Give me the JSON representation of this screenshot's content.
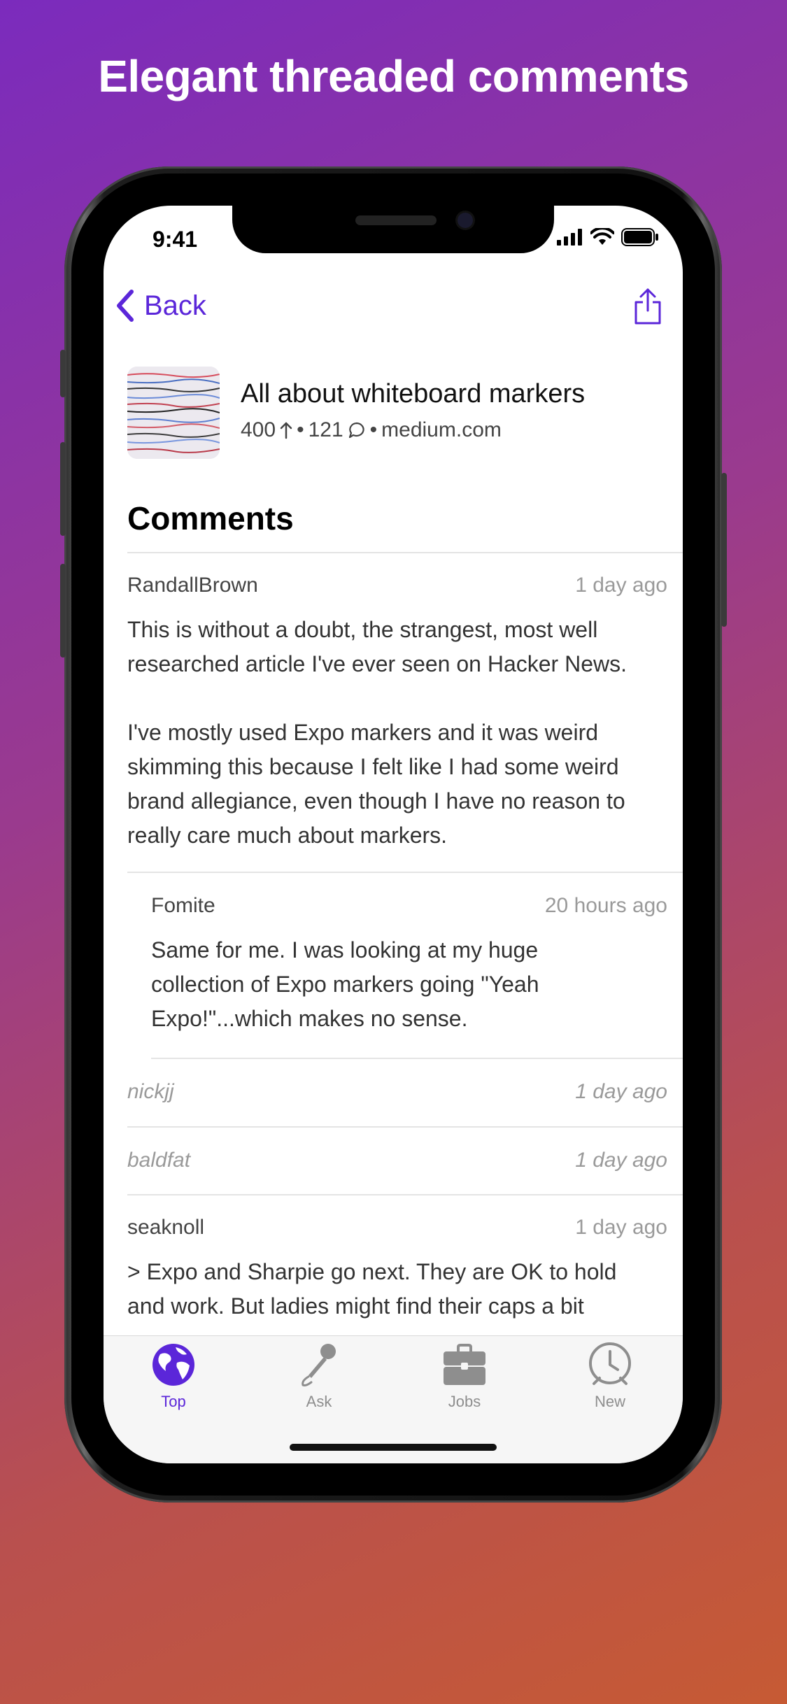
{
  "headline": "Elegant threaded comments",
  "status_bar": {
    "time": "9:41"
  },
  "nav": {
    "back_label": "Back"
  },
  "story": {
    "title": "All about whiteboard markers",
    "points": "400",
    "comments_count": "121",
    "separator": "•",
    "domain": "medium.com"
  },
  "comments_heading": "Comments",
  "comments": [
    {
      "author": "RandallBrown",
      "time": "1 day ago",
      "body": "This is without a doubt, the strangest, most well researched article I've ever seen on Hacker News.\n\nI've mostly used Expo markers and it was weird skimming this because I felt like I had some weird brand allegiance, even though I have no reason to really care much about markers."
    },
    {
      "author": "Fomite",
      "time": "20 hours ago",
      "body": "Same for me. I was looking at my huge collection of Expo markers going \"Yeah Expo!\"...which makes no sense."
    },
    {
      "author": "nickjj",
      "time": "1 day ago"
    },
    {
      "author": "baldfat",
      "time": "1 day ago"
    },
    {
      "author": "seaknoll",
      "time": "1 day ago",
      "body": "> Expo and Sharpie go next. They are OK to hold and work. But ladies might find their caps a bit"
    }
  ],
  "tabs": [
    {
      "label": "Top",
      "icon": "globe-icon",
      "active": true
    },
    {
      "label": "Ask",
      "icon": "microphone-icon",
      "active": false
    },
    {
      "label": "Jobs",
      "icon": "briefcase-icon",
      "active": false
    },
    {
      "label": "New",
      "icon": "clock-icon",
      "active": false
    }
  ],
  "colors": {
    "accent": "#5b26d9",
    "inactive_tab": "#8e8e8e",
    "muted_text": "#9a9a9a"
  }
}
